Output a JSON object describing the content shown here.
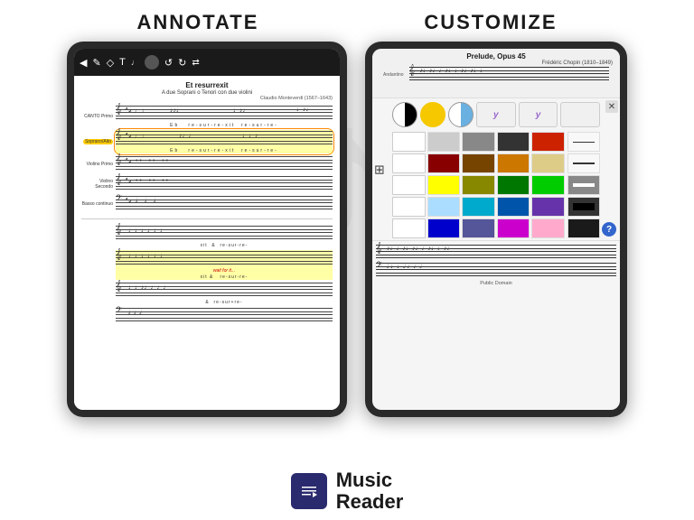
{
  "header": {
    "annotate_label": "ANNOTATE",
    "customize_label": "CUSTOMIZE"
  },
  "left_tablet": {
    "sheet_title": "Et resurrexit",
    "sheet_subtitle": "A due Soprani o Tenori con due violini",
    "sheet_composer": "Claudio Monteverdi (1567–1643)",
    "parts": [
      {
        "label": "CANTO Primo",
        "has_highlight": false,
        "soprano_highlight": false
      },
      {
        "label": "Soprano/Alto",
        "has_highlight": true,
        "soprano_highlight": true
      },
      {
        "label": "",
        "has_highlight": true,
        "soprano_highlight": false
      },
      {
        "label": "Violino Primo",
        "has_highlight": false,
        "soprano_highlight": false
      },
      {
        "label": "Violino Secondo",
        "has_highlight": false,
        "soprano_highlight": false
      },
      {
        "label": "Basso continuo",
        "has_highlight": false,
        "soprano_highlight": false
      }
    ],
    "lyrics1": "Eb        re-sur-re-xit    re-sur-re-",
    "lyrics2": "Eb        re-sur-re-xit    re-sur-re-",
    "lyrics_wait": "wait for it...",
    "lyrics_bottom1": "xit    &   re-sur-re-",
    "lyrics_bottom2": "&   re-sur+re-",
    "toolbar_icons": [
      "◀",
      "✏",
      "◇",
      "T",
      "♩",
      "●",
      "↺",
      "↻",
      "←→"
    ]
  },
  "right_tablet": {
    "score_title": "Prelude, Opus 45",
    "score_composer": "Frédéric Chopin (1810–1849)",
    "score_subtitle": "Andantino",
    "palette": {
      "top_circles": [
        {
          "type": "black-white",
          "label": "black-white circle"
        },
        {
          "type": "yellow",
          "label": "yellow circle"
        },
        {
          "type": "blue-white",
          "label": "blue-white circle"
        }
      ],
      "line_buttons": [
        {
          "label": "y",
          "style": "italic-y"
        },
        {
          "label": "y",
          "style": "italic-y"
        }
      ],
      "colors": [
        "#ffffff",
        "#dddddd",
        "#888888",
        "#444444",
        "#cc0000",
        "#ffffff",
        "#880000",
        "#aa4444",
        "#885500",
        "#cc8800",
        "#ddcc88",
        "#ffffff",
        "#ffff00",
        "#888800",
        "#006600",
        "#00aa00",
        "#00cc00",
        "#ffffff",
        "#aaddff",
        "#00aacc",
        "#007799",
        "#0055aa",
        "#6633aa",
        "#ffffff",
        "#0000cc",
        "#555599",
        "#cc00cc",
        "#ff88cc",
        "#ffccdd",
        "#ffffff"
      ],
      "line_styles": [
        "thin",
        "medium",
        "thick",
        "very-thick"
      ]
    },
    "help_label": "?"
  },
  "footer": {
    "app_name_line1": "Music",
    "app_name_line2": "Reader",
    "logo_icon": "♩"
  }
}
